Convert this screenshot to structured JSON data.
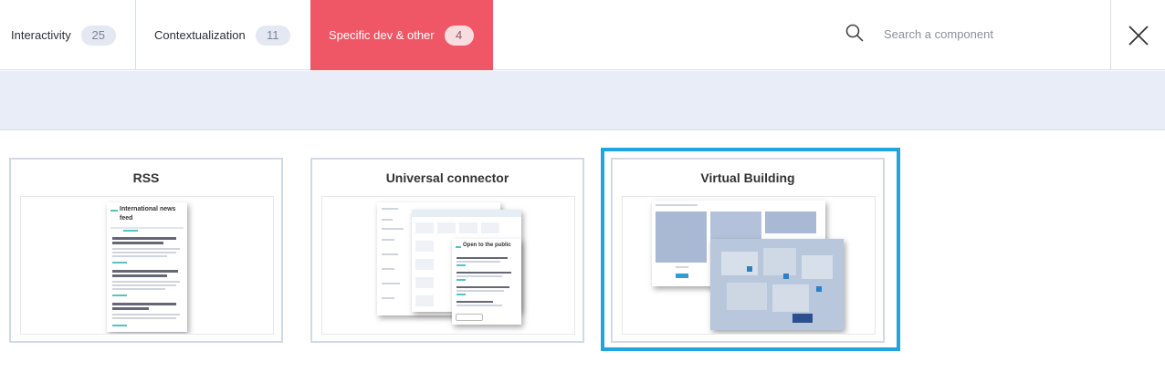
{
  "tabs": [
    {
      "label": "Interactivity",
      "count": "25"
    },
    {
      "label": "Contextualization",
      "count": "11"
    },
    {
      "label": "Specific dev & other",
      "count": "4",
      "active": true
    }
  ],
  "search": {
    "placeholder": "Search a component",
    "value": ""
  },
  "colors": {
    "active_tab": "#ef5766",
    "selected_border": "#1ea7df",
    "band": "#e8edf7"
  },
  "cards": [
    {
      "title": "RSS",
      "preview": {
        "heading": "International news feed"
      }
    },
    {
      "title": "Universal connector",
      "preview": {
        "heading": "Open to the public"
      }
    },
    {
      "title": "Virtual Building",
      "selected": true
    }
  ],
  "icons": {
    "search": "search-icon",
    "close": "close-icon"
  }
}
